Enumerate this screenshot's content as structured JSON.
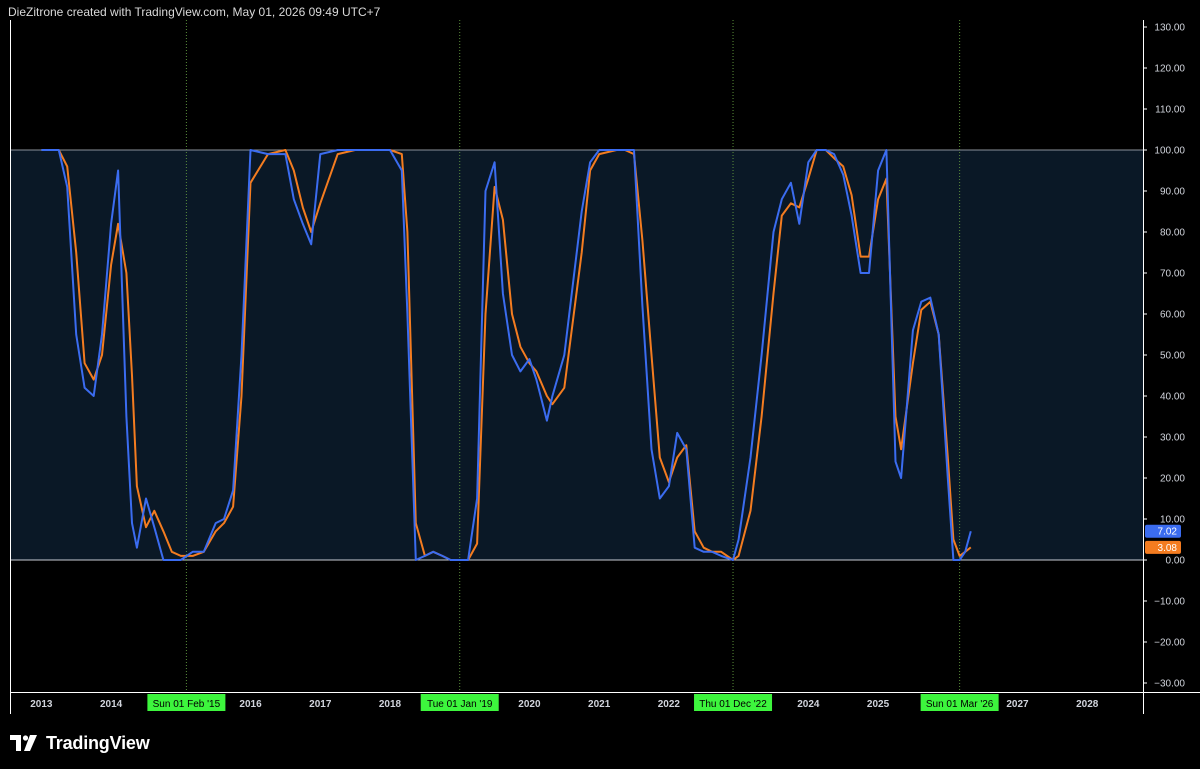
{
  "header": {
    "attribution": "DieZitrone created with TradingView.com, May 01, 2026 09:49 UTC+7"
  },
  "brand": {
    "name": "TradingView",
    "icon": "tradingview-logo-icon"
  },
  "colors": {
    "background": "#000000",
    "band_fill": "#0a1826",
    "k_line": "#3b6cf0",
    "d_line": "#f47c20",
    "marker_green": "#3df53d",
    "axis_text": "#d1d4dc",
    "k_badge": "#3b6cf0",
    "d_badge": "#f47c20"
  },
  "chart_data": {
    "type": "line",
    "ylim": [
      -33,
      130
    ],
    "xlim": [
      2012.55,
      2028.8
    ],
    "y_ticks": [
      "130.00",
      "120.00",
      "110.00",
      "100.00",
      "90.00",
      "80.00",
      "70.00",
      "60.00",
      "50.00",
      "40.00",
      "30.00",
      "20.00",
      "10.00",
      "0.00",
      "−10.00",
      "−20.00",
      "−30.00"
    ],
    "y_tick_values": [
      130,
      120,
      110,
      100,
      90,
      80,
      70,
      60,
      50,
      40,
      30,
      20,
      10,
      0,
      -10,
      -20,
      -30
    ],
    "x_ticks": [
      {
        "label": "2013",
        "x": 2013.0
      },
      {
        "label": "2014",
        "x": 2014.0
      },
      {
        "label": "2016",
        "x": 2016.0
      },
      {
        "label": "2017",
        "x": 2017.0
      },
      {
        "label": "2018",
        "x": 2018.0
      },
      {
        "label": "2020",
        "x": 2020.0
      },
      {
        "label": "2021",
        "x": 2021.0
      },
      {
        "label": "2022",
        "x": 2022.0
      },
      {
        "label": "2024",
        "x": 2024.0
      },
      {
        "label": "2025",
        "x": 2025.0
      },
      {
        "label": "2027",
        "x": 2027.0
      },
      {
        "label": "2028",
        "x": 2028.0
      }
    ],
    "markers": [
      {
        "label": "Sun 01 Feb '15",
        "x": 2015.08
      },
      {
        "label": "Tue 01 Jan '19",
        "x": 2019.0
      },
      {
        "label": "Thu 01 Dec '22",
        "x": 2022.92
      },
      {
        "label": "Sun 01 Mar '26",
        "x": 2026.17
      }
    ],
    "band": [
      0,
      100
    ],
    "last_values": [
      {
        "series": "k",
        "label": "7.02",
        "value": 7.02
      },
      {
        "series": "d",
        "label": "3.08",
        "value": 3.08
      }
    ],
    "series": [
      {
        "id": "k",
        "x": [
          2013.0,
          2013.25,
          2013.37,
          2013.5,
          2013.62,
          2013.75,
          2013.87,
          2014.0,
          2014.1,
          2014.22,
          2014.3,
          2014.37,
          2014.5,
          2014.62,
          2014.75,
          2014.87,
          2015.0,
          2015.17,
          2015.33,
          2015.5,
          2015.62,
          2015.75,
          2015.87,
          2016.0,
          2016.25,
          2016.5,
          2016.62,
          2016.75,
          2016.87,
          2017.0,
          2017.25,
          2017.5,
          2017.75,
          2017.87,
          2018.0,
          2018.17,
          2018.25,
          2018.37,
          2018.5,
          2018.62,
          2018.75,
          2018.87,
          2019.0,
          2019.12,
          2019.25,
          2019.37,
          2019.5,
          2019.62,
          2019.75,
          2019.87,
          2020.0,
          2020.1,
          2020.25,
          2020.33,
          2020.5,
          2020.75,
          2020.87,
          2021.0,
          2021.25,
          2021.37,
          2021.5,
          2021.62,
          2021.75,
          2021.87,
          2022.0,
          2022.12,
          2022.25,
          2022.37,
          2022.5,
          2022.62,
          2022.75,
          2022.92,
          2023.0,
          2023.17,
          2023.33,
          2023.5,
          2023.62,
          2023.75,
          2023.87,
          2024.0,
          2024.12,
          2024.25,
          2024.37,
          2024.5,
          2024.62,
          2024.75,
          2024.87,
          2025.0,
          2025.12,
          2025.25,
          2025.33,
          2025.5,
          2025.62,
          2025.75,
          2025.87,
          2026.0,
          2026.08,
          2026.17,
          2026.25,
          2026.33
        ],
        "y": [
          100,
          100,
          91,
          55,
          42,
          40,
          55,
          82,
          95,
          35,
          9,
          3,
          15,
          8,
          0,
          0,
          0,
          2,
          2,
          9,
          10,
          17,
          50,
          100,
          99,
          99,
          88,
          82,
          77,
          99,
          100,
          100,
          100,
          100,
          100,
          95,
          60,
          0,
          1,
          2,
          1,
          0,
          0,
          0,
          15,
          90,
          97,
          65,
          50,
          46,
          49,
          44,
          34,
          40,
          50,
          85,
          97,
          100,
          100,
          100,
          100,
          62,
          27,
          15,
          18,
          31,
          27,
          3,
          2,
          2,
          1,
          0,
          5,
          25,
          50,
          80,
          88,
          92,
          82,
          97,
          100,
          100,
          99,
          94,
          84,
          70,
          70,
          95,
          100,
          24,
          20,
          56,
          63,
          64,
          55,
          20,
          0,
          0,
          2,
          7.02
        ]
      },
      {
        "id": "d",
        "x": [
          2013.0,
          2013.25,
          2013.37,
          2013.5,
          2013.62,
          2013.75,
          2013.87,
          2014.0,
          2014.1,
          2014.22,
          2014.3,
          2014.37,
          2014.5,
          2014.62,
          2014.75,
          2014.87,
          2015.0,
          2015.17,
          2015.33,
          2015.5,
          2015.62,
          2015.75,
          2015.87,
          2016.0,
          2016.25,
          2016.5,
          2016.62,
          2016.75,
          2016.87,
          2017.0,
          2017.25,
          2017.5,
          2017.75,
          2017.87,
          2018.0,
          2018.17,
          2018.25,
          2018.37,
          2018.5,
          2018.62,
          2018.75,
          2018.87,
          2019.0,
          2019.12,
          2019.25,
          2019.37,
          2019.5,
          2019.62,
          2019.75,
          2019.87,
          2020.0,
          2020.1,
          2020.25,
          2020.33,
          2020.5,
          2020.75,
          2020.87,
          2021.0,
          2021.25,
          2021.37,
          2021.5,
          2021.62,
          2021.75,
          2021.87,
          2022.0,
          2022.12,
          2022.25,
          2022.37,
          2022.5,
          2022.62,
          2022.75,
          2022.92,
          2023.0,
          2023.17,
          2023.33,
          2023.5,
          2023.62,
          2023.75,
          2023.87,
          2024.0,
          2024.12,
          2024.25,
          2024.37,
          2024.5,
          2024.62,
          2024.75,
          2024.87,
          2025.0,
          2025.12,
          2025.25,
          2025.33,
          2025.5,
          2025.62,
          2025.75,
          2025.87,
          2026.0,
          2026.08,
          2026.17,
          2026.25,
          2026.33
        ],
        "y": [
          100,
          100,
          96,
          75,
          48,
          44,
          50,
          72,
          82,
          70,
          45,
          18,
          8,
          12,
          7,
          2,
          1,
          1,
          2,
          7,
          9,
          13,
          40,
          92,
          99,
          100,
          95,
          86,
          80,
          87,
          99,
          100,
          100,
          100,
          100,
          99,
          80,
          9,
          1,
          2,
          1,
          0,
          0,
          0,
          4,
          60,
          91,
          83,
          60,
          52,
          48,
          46,
          40,
          38,
          42,
          75,
          95,
          99,
          100,
          100,
          99,
          78,
          50,
          25,
          19,
          25,
          28,
          7,
          3,
          2,
          2,
          0,
          1,
          12,
          35,
          65,
          84,
          87,
          86,
          93,
          100,
          100,
          98,
          96,
          89,
          74,
          74,
          88,
          93,
          35,
          27,
          48,
          61,
          63,
          55,
          25,
          5,
          1,
          2,
          3.08
        ]
      }
    ]
  }
}
